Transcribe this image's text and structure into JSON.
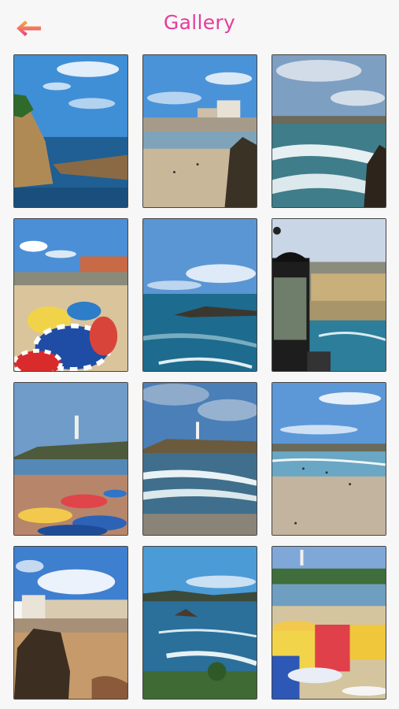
{
  "header": {
    "title": "Gallery",
    "back_icon": "arrow-left-icon"
  },
  "colors": {
    "title": "#e43d9b",
    "arrow_top": "#f8b03a",
    "arrow_bottom": "#ec3c8a",
    "background": "#f7f7f7"
  },
  "gallery": {
    "photos": [
      {
        "name": "photo-coast-cliffs"
      },
      {
        "name": "photo-beach-town-rocks"
      },
      {
        "name": "photo-surf-beach"
      },
      {
        "name": "photo-striped-umbrellas-hotel"
      },
      {
        "name": "photo-sea-horizon"
      },
      {
        "name": "photo-lighthouse-lantern"
      },
      {
        "name": "photo-lighthouse-beach-crowd"
      },
      {
        "name": "photo-lighthouse-cloudy-waves"
      },
      {
        "name": "photo-beach-swimmers"
      },
      {
        "name": "photo-town-rock-beach"
      },
      {
        "name": "photo-rocky-sea"
      },
      {
        "name": "photo-colorful-tents-lighthouse"
      }
    ]
  }
}
